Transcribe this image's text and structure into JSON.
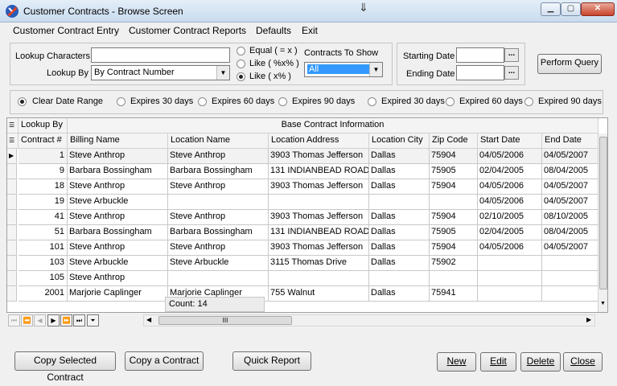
{
  "window": {
    "title": "Customer Contracts - Browse Screen",
    "controls": {
      "minimize": "▁",
      "maximize": "▢",
      "close": "✕"
    },
    "app_icon": "contracts-app-icon",
    "cursor_glyph": "⇓"
  },
  "menu": {
    "items": [
      "Customer Contract Entry",
      "Customer Contract Reports",
      "Defaults",
      "Exit"
    ]
  },
  "lookup": {
    "characters_label": "Lookup Characters",
    "characters_value": "",
    "by_label": "Lookup By",
    "by_value": "By Contract Number",
    "match_options": [
      "Equal ( = x )",
      "Like ( %x% )",
      "Like ( x% )"
    ],
    "match_selected_index": 2,
    "contracts_to_show_label": "Contracts To Show",
    "contracts_to_show_value": "All"
  },
  "dates": {
    "starting_label": "Starting Date",
    "starting_value": "",
    "ending_label": "Ending Date",
    "ending_value": "",
    "picker_glyph": "..."
  },
  "perform_query_label": "Perform Query",
  "date_range": {
    "options": [
      "Clear Date Range",
      "Expires 30 days",
      "Expires 60 days",
      "Expires 90 days",
      "Expired 30 days",
      "Expired 60 days",
      "Expired 90 days"
    ],
    "selected_index": 0
  },
  "grid": {
    "band_lookup": "Lookup By",
    "band_base": "Base Contract Information",
    "columns": [
      "Contract #",
      "Billing Name",
      "Location Name",
      "Location Address",
      "Location City",
      "Zip Code",
      "Start Date",
      "End Date"
    ],
    "rows": [
      [
        "1",
        "Steve Anthrop",
        "Steve Anthrop",
        "3903 Thomas Jefferson",
        "Dallas",
        "75904",
        "04/05/2006",
        "04/05/2007"
      ],
      [
        "9",
        "Barbara Bossingham",
        "Barbara Bossingham",
        "131 INDIANBEAD ROAD",
        "Dallas",
        "75905",
        "02/04/2005",
        "08/04/2005"
      ],
      [
        "18",
        "Steve Anthrop",
        "Steve Anthrop",
        "3903 Thomas Jefferson",
        "Dallas",
        "75904",
        "04/05/2006",
        "04/05/2007"
      ],
      [
        "19",
        "Steve Arbuckle",
        "",
        "",
        "",
        "",
        "04/05/2006",
        "04/05/2007"
      ],
      [
        "41",
        "Steve Anthrop",
        "Steve Anthrop",
        "3903 Thomas Jefferson",
        "Dallas",
        "75904",
        "02/10/2005",
        "08/10/2005"
      ],
      [
        "51",
        "Barbara Bossingham",
        "Barbara Bossingham",
        "131 INDIANBEAD ROAD",
        "Dallas",
        "75905",
        "02/04/2005",
        "08/04/2005"
      ],
      [
        "101",
        "Steve Anthrop",
        "Steve Anthrop",
        "3903 Thomas Jefferson",
        "Dallas",
        "75904",
        "04/05/2006",
        "04/05/2007"
      ],
      [
        "103",
        "Steve Arbuckle",
        "Steve Arbuckle",
        "3115 Thomas Drive",
        "Dallas",
        "75902",
        "",
        ""
      ],
      [
        "105",
        "Steve Anthrop",
        "",
        "",
        "",
        "",
        "",
        ""
      ],
      [
        "2001",
        "Marjorie Caplinger",
        "Marjorie Caplinger",
        "755 Walnut",
        "Dallas",
        "75941",
        "",
        ""
      ]
    ],
    "current_row_index": 0,
    "count_text": "Count: 14",
    "scroll_grip": "III"
  },
  "buttons": {
    "copy_selected": "Copy Selected Contract",
    "copy_a": "Copy a Contract",
    "quick_report": "Quick Report",
    "new": "New",
    "edit": "Edit",
    "delete": "Delete",
    "close": "Close"
  }
}
